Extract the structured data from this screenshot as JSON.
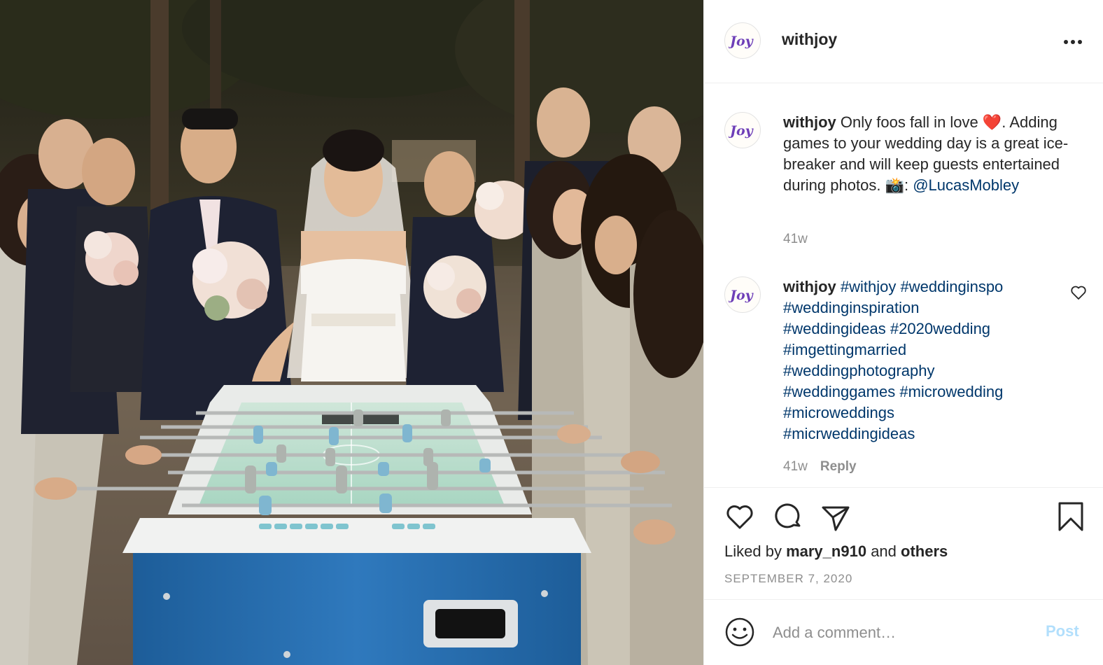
{
  "post": {
    "username": "withjoy",
    "avatar_logo_text": "Joy"
  },
  "caption": {
    "username": "withjoy",
    "text_line1": "Only foos fall in love ",
    "heart_emoji": "❤️",
    "text_line1_end": ".",
    "text_rest": " Adding games to your wedding day is a great ice-breaker and will keep guests entertained during photos. ",
    "camera_emoji": "📸",
    "colon": ": ",
    "mention": "@LucasMobley",
    "age": "41w"
  },
  "hashtag_comment": {
    "username": "withjoy",
    "tags": [
      "#withjoy",
      "#weddinginspo",
      "#weddinginspiration",
      "#weddingideas",
      "#2020wedding",
      "#imgettingmarried",
      "#weddingphotography",
      "#weddinggames",
      "#microwedding",
      "#microweddings",
      "#micrweddingideas"
    ],
    "age": "41w",
    "reply_label": "Reply"
  },
  "likes": {
    "prefix": "Liked by",
    "user": "mary_n910",
    "middle": "and",
    "others": "others"
  },
  "date": "SEPTEMBER 7, 2020",
  "add_comment": {
    "placeholder": "Add a comment…",
    "post_label": "Post"
  },
  "colors": {
    "text": "#262626",
    "secondary": "#8e8e8e",
    "link": "#00376b",
    "post_disabled": "#b2dffc",
    "border": "#efefef"
  },
  "icons": {
    "more": "more-options-icon",
    "like": "heart-icon",
    "comment": "comment-icon",
    "share": "share-icon",
    "save": "bookmark-icon",
    "emoji": "emoji-icon"
  }
}
